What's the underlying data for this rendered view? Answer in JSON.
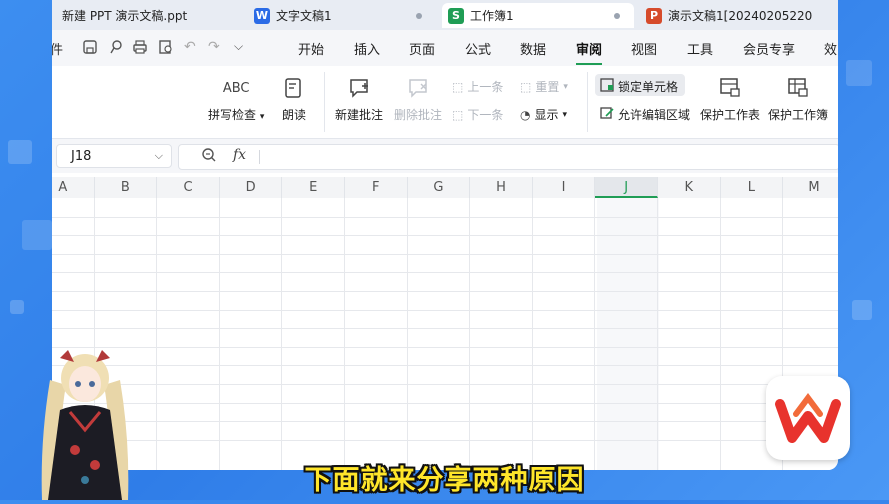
{
  "tabs": [
    {
      "label": "新建 PPT 演示文稿.ppt",
      "badge": "",
      "color": "#d9534f"
    },
    {
      "label": "文字文稿1",
      "badge": "W",
      "color": "#2b6be6"
    },
    {
      "label": "工作簿1",
      "badge": "S",
      "color": "#1f9d55"
    },
    {
      "label": "演示文稿1[20240205220",
      "badge": "P",
      "color": "#d64b2b"
    }
  ],
  "menu": {
    "partial_left": "件",
    "items": [
      "开始",
      "插入",
      "页面",
      "公式",
      "数据",
      "审阅",
      "视图",
      "工具",
      "会员专享",
      "效"
    ],
    "active": "审阅"
  },
  "ribbon": {
    "spell_check": "拼写检查",
    "spell_icon_text": "ABC",
    "read_aloud": "朗读",
    "new_comment": "新建批注",
    "delete_comment": "删除批注",
    "prev": "上一条",
    "next": "下一条",
    "reset": "重置",
    "show": "显示",
    "lock_cell": "锁定单元格",
    "allow_edit": "允许编辑区域",
    "protect_sheet": "保护工作表",
    "protect_book": "保护工作簿"
  },
  "formula_bar": {
    "cell_ref": "J18",
    "fx": "fx",
    "value": ""
  },
  "columns": [
    "A",
    "B",
    "C",
    "D",
    "E",
    "F",
    "G",
    "H",
    "I",
    "J",
    "K",
    "L",
    "M"
  ],
  "selected_column": "J",
  "subtitle": "下面就来分享两种原因",
  "colors": {
    "accent": "#1f9d55",
    "background": "#3d8ef0",
    "subtitle": "#ffe62a"
  }
}
